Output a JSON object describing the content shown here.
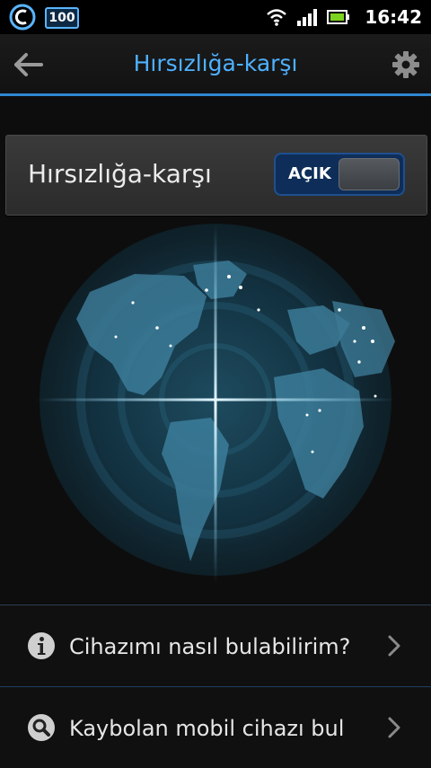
{
  "status_bar": {
    "battery_level_text": "100",
    "time": "16:42",
    "icons": [
      "app-icon",
      "wifi-icon",
      "signal-icon",
      "battery-icon"
    ]
  },
  "action_bar": {
    "title": "Hırsızlığa-karşı",
    "back_icon": "back-arrow-icon",
    "settings_icon": "gear-icon"
  },
  "toggle": {
    "label": "Hırsızlığa-karşı",
    "state_label": "AÇIK",
    "state": "on"
  },
  "list": [
    {
      "icon": "info-icon",
      "label": "Cihazımı nasıl bulabilirim?"
    },
    {
      "icon": "search-icon",
      "label": "Kaybolan mobil cihazı bul"
    }
  ],
  "colors": {
    "accent": "#4eb1ff",
    "underline": "#2f86cf",
    "toggle_bg": "#0e2e59"
  }
}
